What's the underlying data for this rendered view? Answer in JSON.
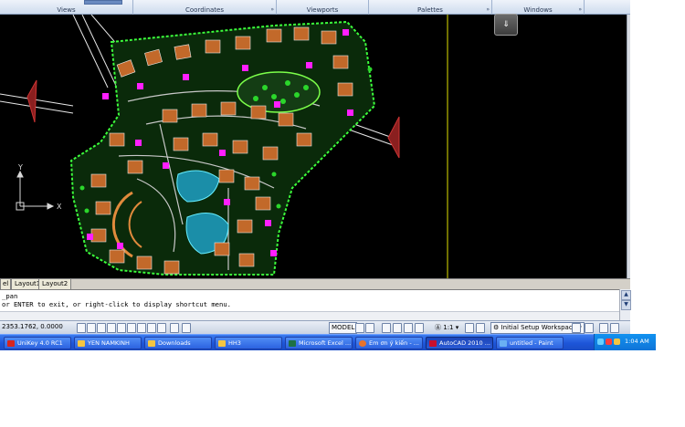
{
  "ribbon": {
    "panels": [
      {
        "label": "Views"
      },
      {
        "label": "Coordinates"
      },
      {
        "label": "Viewports"
      },
      {
        "label": "Palettes"
      },
      {
        "label": "Windows"
      }
    ]
  },
  "drawing": {
    "ucs_y": "Y",
    "ucs_x": "X"
  },
  "layout_tabs": [
    "el",
    "Layout1",
    "Layout2"
  ],
  "command": {
    "line1": "_pan",
    "line2": "or ENTER to exit, or right-click to display shortcut menu."
  },
  "status": {
    "coords": "2353.1762, 0.0000",
    "model": "MODEL",
    "scale": "1:1",
    "workspace": "Initial Setup Workspace"
  },
  "taskbar": {
    "items": [
      {
        "label": "UniKey 4.0 RC1",
        "icon_color": "#d7261e"
      },
      {
        "label": "YEN NAMKINH",
        "icon_color": "#f4c542"
      },
      {
        "label": "Downloads",
        "icon_color": "#f4c542"
      },
      {
        "label": "HH3",
        "icon_color": "#f4c542"
      },
      {
        "label": "Microsoft Excel ...",
        "icon_color": "#1e7145"
      },
      {
        "label": "Em ơn ý kiến - ...",
        "icon_color": "#e8732c"
      },
      {
        "label": "AutoCAD 2010 ...",
        "icon_color": "#c8102e"
      },
      {
        "label": "untitled - Paint",
        "icon_color": "#6ab0f3"
      }
    ],
    "clock": "1:04 AM"
  }
}
